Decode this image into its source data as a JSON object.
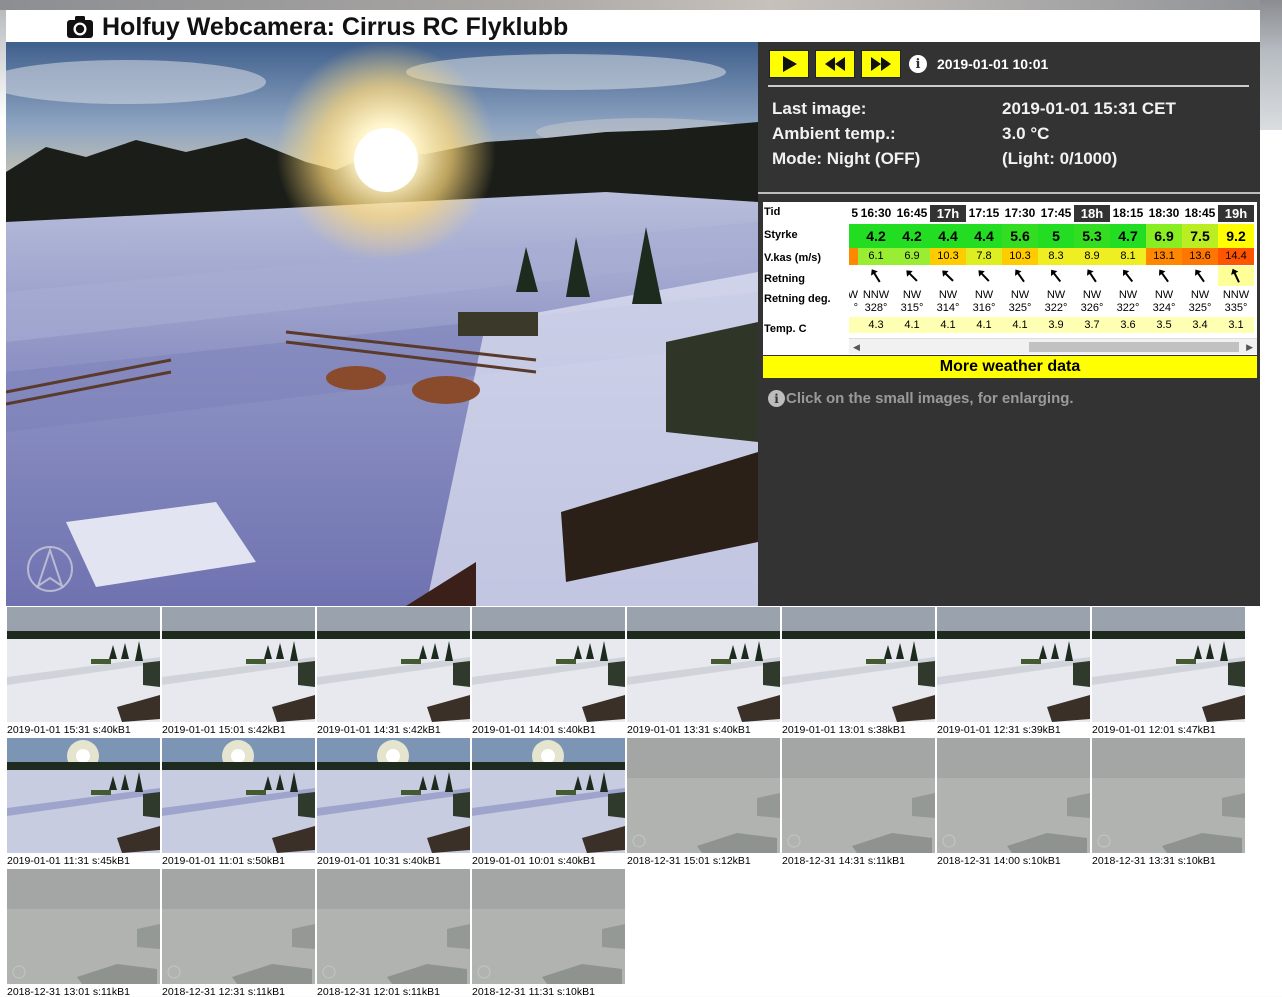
{
  "page": {
    "title": "Holfuy Webcamera: Cirrus RC Flyklubb",
    "icons": {
      "title": "camera-icon",
      "overlay": "compass-arrow-icon"
    }
  },
  "controls": {
    "current_time": "2019-01-01 10:01",
    "buttons": [
      {
        "name": "play",
        "icon": "play-icon"
      },
      {
        "name": "rewind",
        "icon": "rewind-icon"
      },
      {
        "name": "fast-forward",
        "icon": "fast-forward-icon"
      }
    ]
  },
  "status": {
    "last_image_label": "Last image:",
    "last_image_value": "2019-01-01 15:31 CET",
    "ambient_label": "Ambient temp.:",
    "ambient_value": "3.0 °C",
    "mode_label": "Mode: Night (OFF)",
    "mode_value": "(Light: 0/1000)"
  },
  "weather": {
    "row_labels": {
      "time": "Tid",
      "strength": "Styrke",
      "gust": "V.kas (m/s)",
      "direction": "Retning",
      "direction_deg": "Retning deg.",
      "temp": "Temp. C"
    },
    "partial_left": {
      "time": "5",
      "gust": "",
      "dir_text": "W",
      "deg": "°"
    },
    "columns": [
      {
        "time": "16:30",
        "hour": false,
        "strength": "4.2",
        "gust": "6.1",
        "dir_text": "NNW",
        "deg": "328°",
        "angle": 328,
        "temp": "4.3",
        "s_color": "#22dd22",
        "g_color": "#99ee33"
      },
      {
        "time": "16:45",
        "hour": false,
        "strength": "4.2",
        "gust": "6.9",
        "dir_text": "NW",
        "deg": "315°",
        "angle": 315,
        "temp": "4.1",
        "s_color": "#22dd22",
        "g_color": "#99ee33"
      },
      {
        "time": "17h",
        "hour": true,
        "strength": "4.4",
        "gust": "10.3",
        "dir_text": "NW",
        "deg": "314°",
        "angle": 314,
        "temp": "4.1",
        "s_color": "#22dd22",
        "g_color": "#ffcc00"
      },
      {
        "time": "17:15",
        "hour": false,
        "strength": "4.4",
        "gust": "7.8",
        "dir_text": "NW",
        "deg": "316°",
        "angle": 316,
        "temp": "4.1",
        "s_color": "#22dd22",
        "g_color": "#ddee22"
      },
      {
        "time": "17:30",
        "hour": false,
        "strength": "5.6",
        "gust": "10.3",
        "dir_text": "NW",
        "deg": "325°",
        "angle": 325,
        "temp": "4.1",
        "s_color": "#33dd22",
        "g_color": "#ffcc00"
      },
      {
        "time": "17:45",
        "hour": false,
        "strength": "5",
        "gust": "8.3",
        "dir_text": "NW",
        "deg": "322°",
        "angle": 322,
        "temp": "3.9",
        "s_color": "#22dd22",
        "g_color": "#eeee22"
      },
      {
        "time": "18h",
        "hour": true,
        "strength": "5.3",
        "gust": "8.9",
        "dir_text": "NW",
        "deg": "326°",
        "angle": 326,
        "temp": "3.7",
        "s_color": "#33dd22",
        "g_color": "#eeee22"
      },
      {
        "time": "18:15",
        "hour": false,
        "strength": "4.7",
        "gust": "8.1",
        "dir_text": "NW",
        "deg": "322°",
        "angle": 322,
        "temp": "3.6",
        "s_color": "#22dd22",
        "g_color": "#eeee22"
      },
      {
        "time": "18:30",
        "hour": false,
        "strength": "6.9",
        "gust": "13.1",
        "dir_text": "NW",
        "deg": "324°",
        "angle": 324,
        "temp": "3.5",
        "s_color": "#88ee22",
        "g_color": "#ff8800"
      },
      {
        "time": "18:45",
        "hour": false,
        "strength": "7.5",
        "gust": "13.6",
        "dir_text": "NW",
        "deg": "325°",
        "angle": 325,
        "temp": "3.4",
        "s_color": "#bbee22",
        "g_color": "#ff7700"
      },
      {
        "time": "19h",
        "hour": true,
        "strength": "9.2",
        "gust": "14.4",
        "dir_text": "NNW",
        "deg": "335°",
        "angle": 335,
        "temp": "3.1",
        "s_color": "#ffff00",
        "g_color": "#ff5500",
        "dir_highlight": true
      }
    ],
    "more_label": "More weather data",
    "hint": "Click on the small images, for enlarging."
  },
  "thumbnails": [
    {
      "caption": "2019-01-01 15:31 s:40kB1",
      "scene": "clear"
    },
    {
      "caption": "2019-01-01 15:01 s:42kB1",
      "scene": "clear"
    },
    {
      "caption": "2019-01-01 14:31 s:42kB1",
      "scene": "clear"
    },
    {
      "caption": "2019-01-01 14:01 s:40kB1",
      "scene": "clear"
    },
    {
      "caption": "2019-01-01 13:31 s:40kB1",
      "scene": "clear"
    },
    {
      "caption": "2019-01-01 13:01 s:38kB1",
      "scene": "clear"
    },
    {
      "caption": "2019-01-01 12:31 s:39kB1",
      "scene": "clear"
    },
    {
      "caption": "2019-01-01 12:01 s:47kB1",
      "scene": "clear"
    },
    {
      "caption": "2019-01-01 11:31 s:45kB1",
      "scene": "sun"
    },
    {
      "caption": "2019-01-01 11:01 s:50kB1",
      "scene": "sun"
    },
    {
      "caption": "2019-01-01 10:31 s:40kB1",
      "scene": "sun"
    },
    {
      "caption": "2019-01-01 10:01 s:40kB1",
      "scene": "sun"
    },
    {
      "caption": "2018-12-31 15:01 s:12kB1",
      "scene": "fog"
    },
    {
      "caption": "2018-12-31 14:31 s:11kB1",
      "scene": "fog"
    },
    {
      "caption": "2018-12-31 14:00 s:10kB1",
      "scene": "fog"
    },
    {
      "caption": "2018-12-31 13:31 s:10kB1",
      "scene": "fog"
    },
    {
      "caption": "2018-12-31 13:01 s:11kB1",
      "scene": "fog"
    },
    {
      "caption": "2018-12-31 12:31 s:11kB1",
      "scene": "fog"
    },
    {
      "caption": "2018-12-31 12:01 s:11kB1",
      "scene": "fog"
    },
    {
      "caption": "2018-12-31 11:31 s:10kB1",
      "scene": "fog"
    }
  ]
}
